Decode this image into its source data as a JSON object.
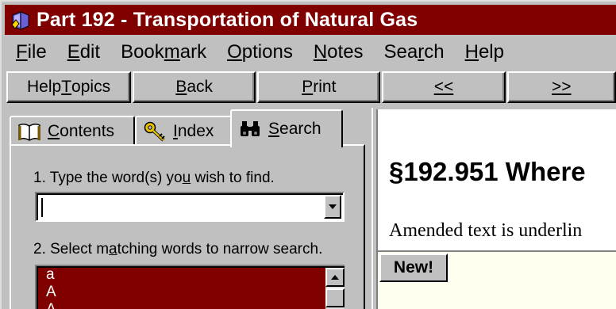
{
  "window": {
    "title": "Part 192 - Transportation of Natural Gas"
  },
  "menu": [
    {
      "pre": "",
      "key": "F",
      "post": "ile"
    },
    {
      "pre": "",
      "key": "E",
      "post": "dit"
    },
    {
      "pre": "Book",
      "key": "m",
      "post": "ark"
    },
    {
      "pre": "",
      "key": "O",
      "post": "ptions"
    },
    {
      "pre": "",
      "key": "N",
      "post": "otes"
    },
    {
      "pre": "Sea",
      "key": "r",
      "post": "ch"
    },
    {
      "pre": "",
      "key": "H",
      "post": "elp"
    }
  ],
  "toolbar": {
    "help_pre": "Help ",
    "help_key": "T",
    "help_post": "opics",
    "back_key": "B",
    "back_post": "ack",
    "print_key": "P",
    "print_post": "rint",
    "prev_label": "<<",
    "next_label": ">>"
  },
  "tabs": {
    "contents_key": "C",
    "contents_post": "ontents",
    "index_key": "I",
    "index_post": "ndex",
    "search_key": "S",
    "search_post": "earch"
  },
  "search": {
    "step1_pre": "1. Type the word(s) yo",
    "step1_key": "u",
    "step1_post": " wish to find.",
    "input_value": "",
    "step2_pre": "2. Select m",
    "step2_key": "a",
    "step2_post": "tching words to narrow search.",
    "matching_words": [
      "a",
      "A",
      "A"
    ]
  },
  "content": {
    "heading": "§192.951 Where",
    "paragraph": "Amended text is underlin",
    "new_label": "New!"
  },
  "colors": {
    "titlebar": "#800000",
    "listbox_selected": "#800000",
    "desktop": "#1a0f8a",
    "chrome": "#c0c0c0"
  }
}
